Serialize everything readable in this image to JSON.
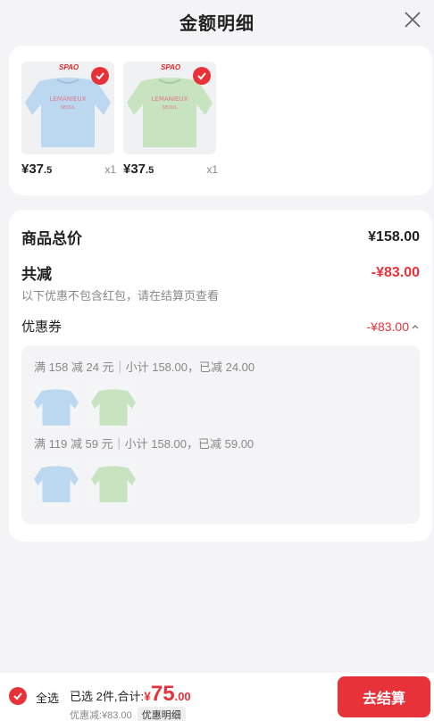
{
  "header": {
    "title": "金额明细"
  },
  "products": [
    {
      "brand": "SPAO",
      "price_int": "¥37",
      "price_dec": ".5",
      "qty": "x1",
      "color": "#bcd8f0"
    },
    {
      "brand": "SPAO",
      "price_int": "¥37",
      "price_dec": ".5",
      "qty": "x1",
      "color": "#c7e3bf"
    }
  ],
  "detail": {
    "total_label": "商品总价",
    "total_value": "¥158.00",
    "discount_label": "共减",
    "discount_value": "-¥83.00",
    "note": "以下优惠不包含红包，请在结算页查看",
    "coupon_label": "优惠券",
    "coupon_value": "-¥83.00",
    "rules": [
      {
        "text": "满 158 减 24 元｜小计 158.00，已减 24.00"
      },
      {
        "text": "满 119 减 59 元｜小计 158.00，已减 59.00"
      }
    ]
  },
  "bottom": {
    "select_all": "全选",
    "selected": "已选 2件,合计:",
    "total_currency": "¥",
    "total_int": "75",
    "total_dec": ".00",
    "discount": "优惠减:¥83.00",
    "detail_chip": "优惠明细",
    "checkout": "去结算"
  },
  "colors": {
    "accent": "#e8323a",
    "background": "#f4f4f6"
  }
}
